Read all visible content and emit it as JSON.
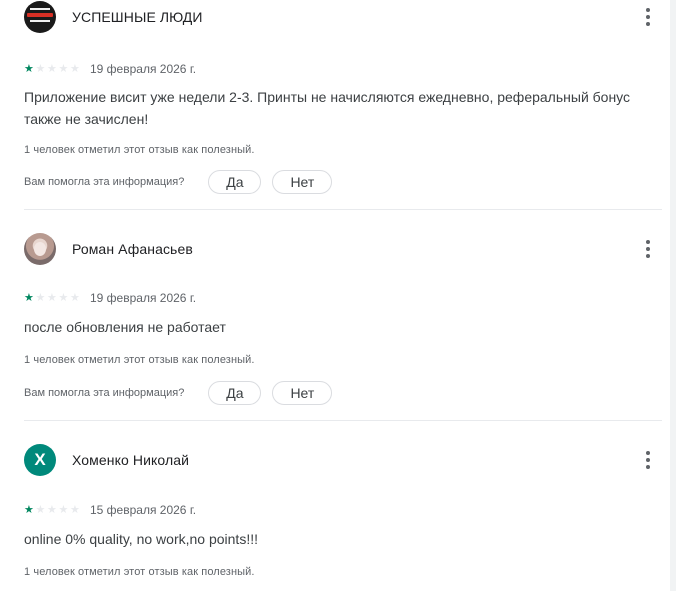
{
  "reviews": [
    {
      "author": "УСПЕШНЫЕ ЛЮДИ",
      "avatar_icon": "brand-logo-avatar",
      "rating": 1,
      "max_rating": 5,
      "date": "19 февраля 2026 г.",
      "text": "Приложение висит уже недели 2-3. Принты не начисляются ежедневно, реферальный бонус также не зачислен!",
      "helpful_count": "1 человек отметил этот отзыв как полезный.",
      "feedback_question": "Вам помогла эта информация?",
      "yes_label": "Да",
      "no_label": "Нет"
    },
    {
      "author": "Роман Афанасьев",
      "avatar_icon": "user-photo-avatar",
      "rating": 1,
      "max_rating": 5,
      "date": "19 февраля 2026 г.",
      "text": "после обновления не работает",
      "helpful_count": "1 человек отметил этот отзыв как полезный.",
      "feedback_question": "Вам помогла эта информация?",
      "yes_label": "Да",
      "no_label": "Нет"
    },
    {
      "author": "Хоменко Николай",
      "avatar_letter": "Х",
      "avatar_color": "#00897b",
      "rating": 1,
      "max_rating": 5,
      "date": "15 февраля 2026 г.",
      "text": "online 0% quality, no work,no points!!!",
      "helpful_count": "1 человек отметил этот отзыв как полезный."
    }
  ],
  "colors": {
    "star_filled": "#01875f",
    "star_empty": "#e8eaed",
    "divider": "#e8eaed",
    "secondary_text": "#5f6368"
  }
}
